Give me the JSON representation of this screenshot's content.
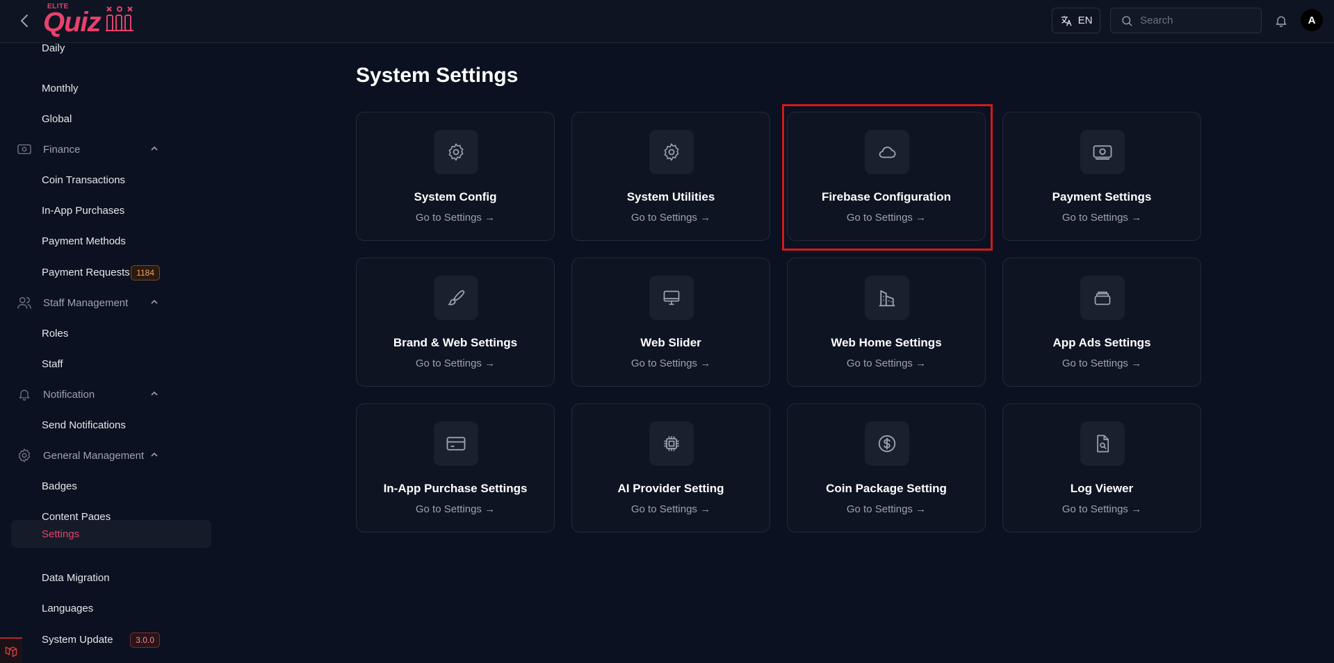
{
  "header": {
    "logo_small": "ELITE",
    "logo_main": "Quiz",
    "language": "EN",
    "search_placeholder": "Search",
    "avatar_initial": "A"
  },
  "sidebar": {
    "items": [
      {
        "label": "Daily",
        "type": "sub"
      },
      {
        "label": "Monthly",
        "type": "sub"
      },
      {
        "label": "Global",
        "type": "sub"
      },
      {
        "label": "Finance",
        "type": "group",
        "icon": "money-icon"
      },
      {
        "label": "Coin Transactions",
        "type": "sub"
      },
      {
        "label": "In-App Purchases",
        "type": "sub"
      },
      {
        "label": "Payment Methods",
        "type": "sub"
      },
      {
        "label": "Payment Requests",
        "type": "sub",
        "badge": "1184"
      },
      {
        "label": "Staff Management",
        "type": "group",
        "icon": "users-icon"
      },
      {
        "label": "Roles",
        "type": "sub"
      },
      {
        "label": "Staff",
        "type": "sub"
      },
      {
        "label": "Notification",
        "type": "group",
        "icon": "bell-icon"
      },
      {
        "label": "Send Notifications",
        "type": "sub"
      },
      {
        "label": "General Management",
        "type": "group",
        "icon": "gear-icon"
      },
      {
        "label": "Badges",
        "type": "sub"
      },
      {
        "label": "Content Pages",
        "type": "sub"
      },
      {
        "label": "Settings",
        "type": "sub",
        "active": true
      },
      {
        "label": "Data Migration",
        "type": "sub"
      },
      {
        "label": "Languages",
        "type": "sub"
      },
      {
        "label": "System Update",
        "type": "sub",
        "badge": "3.0.0"
      }
    ]
  },
  "main": {
    "title": "System Settings",
    "cards": [
      {
        "title": "System Config",
        "link": "Go to Settings →",
        "icon": "gear-icon"
      },
      {
        "title": "System Utilities",
        "link": "Go to Settings →",
        "icon": "gear-icon"
      },
      {
        "title": "Firebase Configuration",
        "link": "Go to Settings →",
        "icon": "cloud-icon"
      },
      {
        "title": "Payment Settings",
        "link": "Go to Settings →",
        "icon": "money-icon"
      },
      {
        "title": "Brand & Web Settings",
        "link": "Go to Settings →",
        "icon": "paintbrush-icon"
      },
      {
        "title": "Web Slider",
        "link": "Go to Settings →",
        "icon": "monitor-icon"
      },
      {
        "title": "Web Home Settings",
        "link": "Go to Settings →",
        "icon": "building-icon"
      },
      {
        "title": "App Ads Settings",
        "link": "Go to Settings →",
        "icon": "stack-icon"
      },
      {
        "title": "In-App Purchase Settings",
        "link": "Go to Settings →",
        "icon": "credit-card-icon"
      },
      {
        "title": "AI Provider Setting",
        "link": "Go to Settings →",
        "icon": "cpu-chip-icon"
      },
      {
        "title": "Coin Package Setting",
        "link": "Go to Settings →",
        "icon": "dollar-icon"
      },
      {
        "title": "Log Viewer",
        "link": "Go to Settings →",
        "icon": "document-search-icon"
      }
    ]
  },
  "colors": {
    "accent": "#e8416c",
    "highlight": "#d11a1a"
  }
}
